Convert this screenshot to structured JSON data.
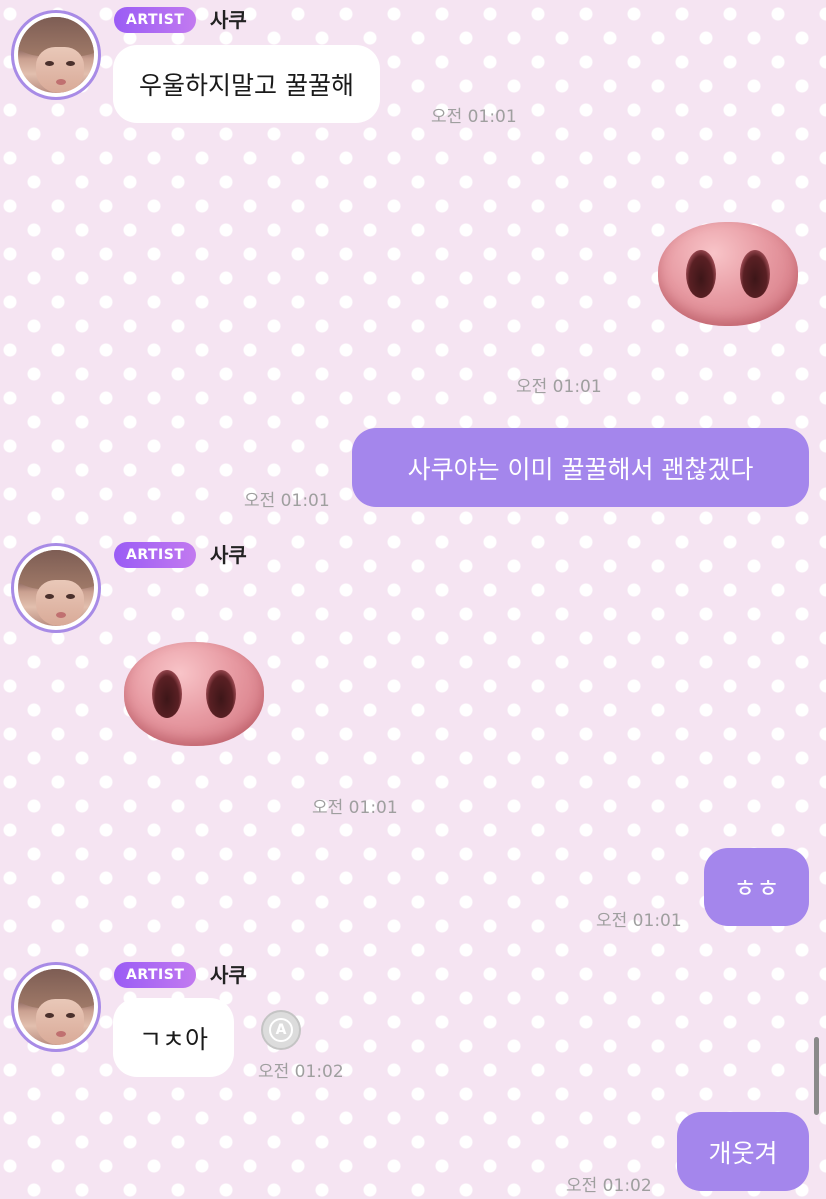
{
  "colors": {
    "accent": "#a486ec",
    "badge": "#9a5cf5",
    "incoming_bubble": "#ffffff",
    "timestamp": "#9f9f9f"
  },
  "artist": {
    "badge": "ARTIST",
    "name": "사쿠"
  },
  "messages": [
    {
      "from": "artist",
      "text": "우울하지말고 꿀꿀해",
      "time": "오전 01:01"
    },
    {
      "from": "me",
      "type": "sticker",
      "sticker": "pig-nose",
      "time": "오전 01:01"
    },
    {
      "from": "me",
      "text": "사쿠야는 이미 꿀꿀해서 괜찮겠다",
      "time": "오전 01:01"
    },
    {
      "from": "artist",
      "type": "sticker",
      "sticker": "pig-nose",
      "time": "오전 01:01"
    },
    {
      "from": "me",
      "text": "ㅎㅎ",
      "time": "오전 01:01"
    },
    {
      "from": "artist",
      "text": "ㄱㅊ아",
      "time": "오전 01:02",
      "translate_icon": "A"
    },
    {
      "from": "me",
      "text": "개웃겨",
      "time": "오전 01:02"
    }
  ]
}
